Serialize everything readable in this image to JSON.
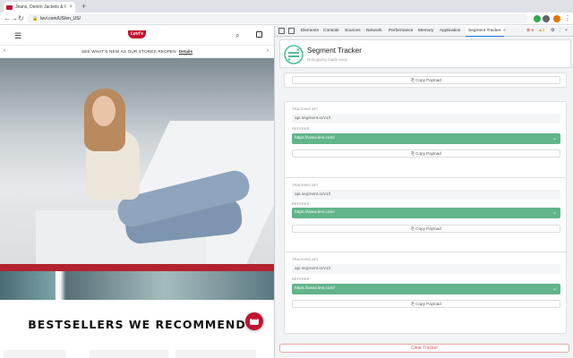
{
  "browser": {
    "tab_title": "Jeans, Denim Jackets & Clothi...",
    "tab_close": "×",
    "new_tab": "+",
    "url": "levi.com/US/en_US/",
    "back": "←",
    "forward": "→",
    "reload": "↻"
  },
  "site": {
    "logo": "Levi's",
    "promo_text": "SEE WHAT'S NEW AS OUR STORES REOPEN",
    "promo_link": "Details",
    "promo_prev": "‹",
    "promo_next": "›",
    "headline": "BESTSELLERS WE RECOMMEND",
    "chat_dots": "•••"
  },
  "devtools": {
    "tabs": [
      "Elements",
      "Console",
      "Sources",
      "Network",
      "Performance",
      "Memory",
      "Application",
      "Segment Tracker"
    ],
    "active_tab": "Segment Tracker",
    "more": "»",
    "errors": "⊗ 6",
    "warnings": "▲4",
    "settings": "⚙",
    "menu": "⋮",
    "close": "×"
  },
  "tracker": {
    "title": "Segment Tracker",
    "subtitle": "Debugging made easy",
    "copy_label": "Copy Payload",
    "tracking_label": "TRACKING API",
    "referer_label": "REFERER",
    "entries": [
      {
        "tracking_api": "api.segment.io/v1/t",
        "referer": "https://www.levi.com/"
      },
      {
        "tracking_api": "api.segment.io/v1/t",
        "referer": "https://www.levi.com/"
      },
      {
        "tracking_api": "api.segment.io/v1/t",
        "referer": "https://www.levi.com/"
      }
    ],
    "clear_label": "Clear Tracker"
  },
  "colors": {
    "levis_red": "#c41230",
    "select_green": "#62b48a",
    "active_tab_blue": "#1a73e8"
  }
}
